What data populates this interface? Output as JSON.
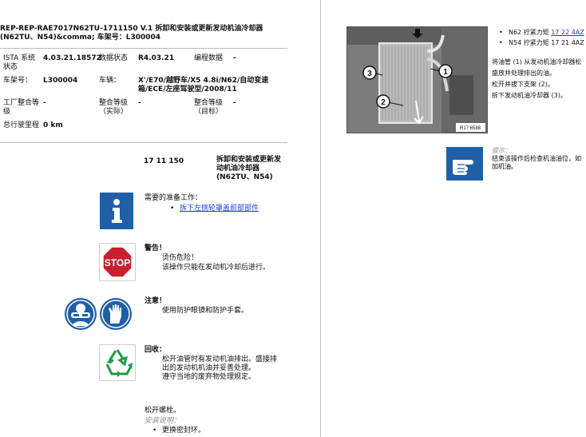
{
  "header": {
    "doc_title": "REP-REP-RAE7017N62TU-1711150  V.1   拆卸和安装或更新发动机油冷却器 (N62TU、N54)&comma; 车架号：L300004"
  },
  "info_table": {
    "ista_label": "ISTA 系统状态",
    "ista_value": "4.03.21.18572",
    "data_status_label": "数据状态",
    "data_status_value": "R4.03.21",
    "programming_label": "编程数据",
    "programming_value": "-",
    "vin_label": "车架号：",
    "vin_value": "L300004",
    "vehicle_label": "车辆：",
    "vehicle_value": "X'/E70/越野车/X5 4.8i/N62/自动变速箱/ECE/左座驾驶型/2008/11",
    "factory_label": "工厂整合等级",
    "factory_value": "-",
    "integ_actual_label": "整合等级（实际）",
    "integ_actual_value": "-",
    "integ_target_label": "整合等级（目标）",
    "integ_target_value": "-",
    "odometer_label": "总行驶里程",
    "odometer_value": "0 km"
  },
  "procedure": {
    "code": "17 11 150",
    "title": "拆卸和安装或更新发动机油冷却器 (N62TU、N54)"
  },
  "sections": {
    "prep_title": "需要的准备工作：",
    "prep_link": "拆下左侧轮罩盖前部部件",
    "warning_title": "警告！",
    "warning_line1": "烫伤危险！",
    "warning_line2": "该操作只能在发动机冷却后进行。",
    "stop_text": "STOP",
    "caution_title": "注意！",
    "caution_line1": "使用防护眼镜和防护手套。",
    "recycle_title": "回收：",
    "recycle_line1": "松开油管时有发动机油排出。盛接排出的发动机机油并妥善处理。",
    "recycle_line2": "遵守当地的废弃物处理规定。",
    "loosen_screws": "松开螺栓。",
    "install_note_label": "安装说明：",
    "install_note_item": "更换密封环。"
  },
  "right": {
    "torque_n62_prefix": "N62 拧紧力矩 ",
    "torque_n62_link": "17 22 4AZ",
    "torque_n54": "N54 拧紧力矩 17 21 4AZ",
    "step_text_1": "将油管 (1) 从发动机油冷却器松",
    "step_text_2": "盛放并处理排出的油。",
    "step_text_3": "松开并拔下支架 (2)。",
    "step_text_4": "拆下发动机油冷却器 (3)。",
    "photo_callouts": [
      "1",
      "2",
      "3"
    ],
    "photo_ref": "R17 6588",
    "hint_label": "提示：",
    "hint_text_1": "结束该操作后检查机油油位，如",
    "hint_text_2": "加机油。"
  },
  "icons": {
    "info": "info-icon",
    "stop": "stop-sign-icon",
    "goggles": "safety-goggles-icon",
    "gloves": "safety-gloves-icon",
    "recycle": "recycle-icon",
    "hint": "pointing-hand-icon"
  },
  "colors": {
    "icon_blue": "#1f5fa8",
    "stop_red": "#c8202f",
    "recycle_green": "#1e9a46",
    "link_blue": "#1a3fd6"
  }
}
